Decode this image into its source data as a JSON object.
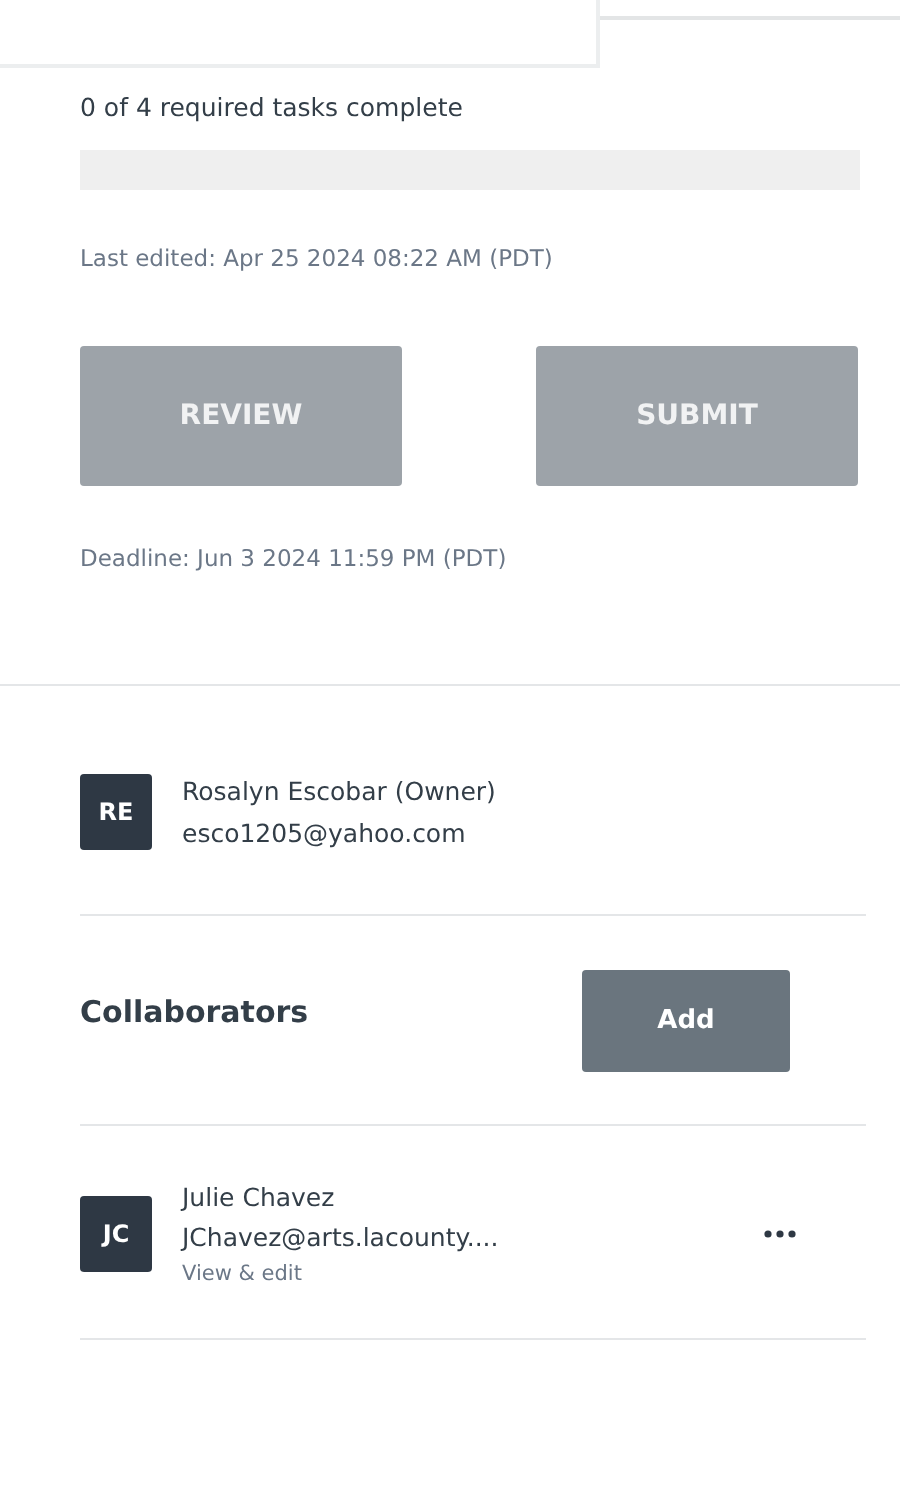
{
  "progress": {
    "label": "0 of 4 required tasks complete",
    "level": 0
  },
  "last_edited": "Last edited: Apr 25 2024 08:22 AM (PDT)",
  "buttons": [
    {
      "label": "REVIEW",
      "disabled": true
    },
    {
      "label": "SUBMIT",
      "disabled": true
    }
  ],
  "deadline": "Deadline: Jun 3 2024 11:59 PM (PDT)",
  "owner": {
    "initials": "RE",
    "name": "Rosalyn Escobar (Owner)",
    "email": "esco1205@yahoo.com"
  },
  "collaborators": {
    "title": "Collaborators",
    "add_button": "Add",
    "people": [
      {
        "initials": "JC",
        "name": "Julie Chavez",
        "email": "JChavez@arts.lacounty....",
        "permission": "View & edit"
      }
    ]
  }
}
